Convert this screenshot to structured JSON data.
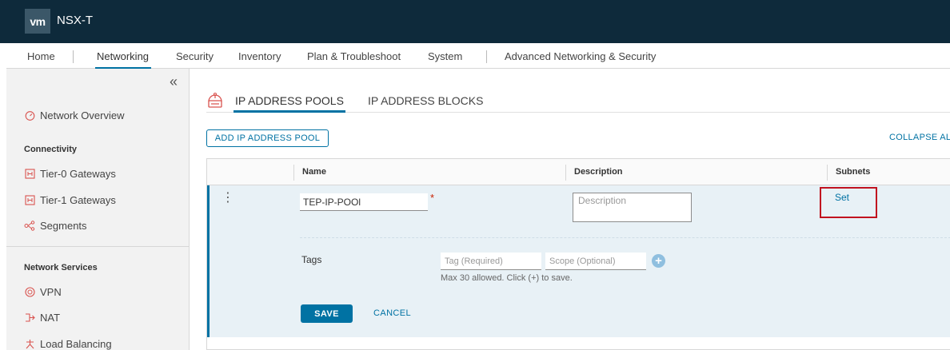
{
  "header": {
    "logo": "vm",
    "title": "NSX-T"
  },
  "nav": {
    "items": [
      "Home",
      "Networking",
      "Security",
      "Inventory",
      "Plan & Troubleshoot",
      "System",
      "Advanced Networking & Security"
    ],
    "active": "Networking"
  },
  "sidebar": {
    "collapse_icon": "«",
    "overview": "Network Overview",
    "sections": [
      {
        "title": "Connectivity",
        "items": [
          "Tier-0 Gateways",
          "Tier-1 Gateways",
          "Segments"
        ]
      },
      {
        "title": "Network Services",
        "items": [
          "VPN",
          "NAT",
          "Load Balancing"
        ]
      }
    ]
  },
  "content": {
    "tabs": [
      "IP ADDRESS POOLS",
      "IP ADDRESS BLOCKS"
    ],
    "active_tab": "IP ADDRESS POOLS",
    "add_button": "ADD IP ADDRESS POOL",
    "collapse_all": "COLLAPSE AL",
    "columns": [
      "Name",
      "Description",
      "Subnets"
    ],
    "row": {
      "name_value": "TEP-IP-POOl",
      "required_mark": "*",
      "description_placeholder": "Description",
      "subnets_link": "Set",
      "tags_label": "Tags",
      "tag_placeholder": "Tag (Required)",
      "scope_placeholder": "Scope (Optional)",
      "add_tag_icon": "+",
      "hint": "Max 30 allowed. Click (+) to save.",
      "save": "SAVE",
      "cancel": "CANCEL"
    }
  },
  "colors": {
    "header_bg": "#0e2a3b",
    "accent": "#0072a3",
    "highlight_box": "#c1121f",
    "row_bg": "#e8f1f6"
  }
}
